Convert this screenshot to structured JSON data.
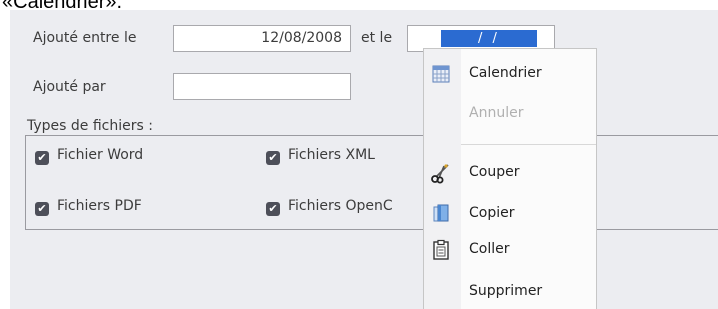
{
  "caption": "«Calendrier».",
  "form": {
    "date_range_label": "Ajouté entre le",
    "date_from_value": "12/08/2008",
    "and_label": "et le",
    "date_to_value": "/ /",
    "added_by_label": "Ajouté par",
    "added_by_value": "",
    "file_types_label": "Types de fichiers :",
    "checkboxes": [
      {
        "label": "Fichier Word",
        "checked": true
      },
      {
        "label": "Fichiers XML",
        "checked": true
      },
      {
        "label": "Fichiers PDF",
        "checked": true
      },
      {
        "label": "Fichiers OpenC",
        "checked": true
      }
    ]
  },
  "context_menu": {
    "items": [
      {
        "label": "Calendrier",
        "icon": "calendar-icon",
        "enabled": true
      },
      {
        "label": "Annuler",
        "icon": "",
        "enabled": false
      },
      {
        "label": "Couper",
        "icon": "scissors-icon",
        "enabled": true
      },
      {
        "label": "Copier",
        "icon": "copy-icon",
        "enabled": true
      },
      {
        "label": "Coller",
        "icon": "paste-icon",
        "enabled": true
      },
      {
        "label": "Supprimer",
        "icon": "",
        "enabled": true
      }
    ]
  },
  "colors": {
    "panel_bg": "#ecedf1",
    "selection": "#2b6bd1",
    "checkbox": "#4d4f59"
  }
}
